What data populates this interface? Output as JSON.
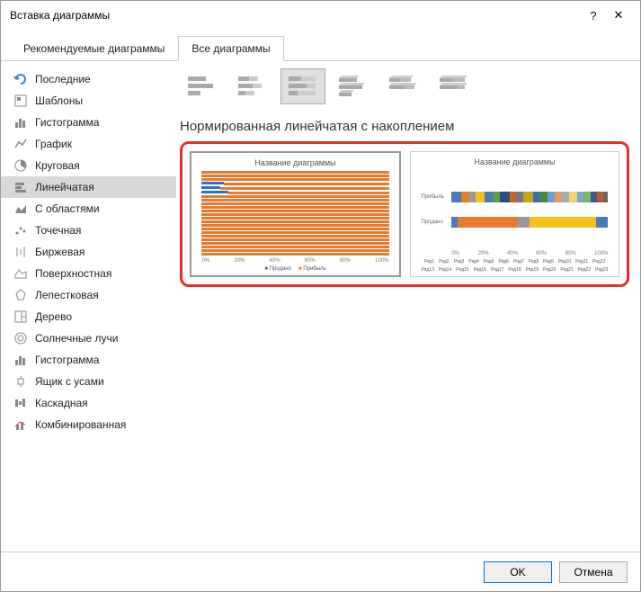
{
  "title": "Вставка диаграммы",
  "help": "?",
  "close": "✕",
  "tabs": {
    "rec": "Рекомендуемые диаграммы",
    "all": "Все диаграммы"
  },
  "sidebar": {
    "items": [
      {
        "label": "Последние"
      },
      {
        "label": "Шаблоны"
      },
      {
        "label": "Гистограмма"
      },
      {
        "label": "График"
      },
      {
        "label": "Круговая"
      },
      {
        "label": "Линейчатая"
      },
      {
        "label": "С областями"
      },
      {
        "label": "Точечная"
      },
      {
        "label": "Биржевая"
      },
      {
        "label": "Поверхностная"
      },
      {
        "label": "Лепестковая"
      },
      {
        "label": "Дерево"
      },
      {
        "label": "Солнечные лучи"
      },
      {
        "label": "Гистограмма"
      },
      {
        "label": "Ящик с усами"
      },
      {
        "label": "Каскадная"
      },
      {
        "label": "Комбинированная"
      }
    ]
  },
  "subtitle": "Нормированная линейчатая с накоплением",
  "preview": {
    "chart_title": "Название диаграммы",
    "legend1": {
      "a": "Продано",
      "b": "Прибыль"
    }
  },
  "chart_data": [
    {
      "type": "bar",
      "orientation": "horizontal-stacked-100",
      "title": "Название диаграммы",
      "xlabel": "",
      "ylabel": "",
      "x_ticks": [
        "0%",
        "20%",
        "40%",
        "60%",
        "80%",
        "100%"
      ],
      "series": [
        {
          "name": "Продано",
          "color": "#3a6fb5"
        },
        {
          "name": "Прибыль",
          "color": "#e87a2e"
        }
      ],
      "categories_count": 23,
      "note": "majority rows ~100% Прибыль; three rows near top show ~10-15% Продано segment"
    },
    {
      "type": "bar",
      "orientation": "horizontal-stacked-100",
      "title": "Название диаграммы",
      "categories": [
        "Прибыль",
        "Продано"
      ],
      "x_ticks": [
        "0%",
        "20%",
        "40%",
        "60%",
        "80%",
        "100%"
      ],
      "series_names": [
        "Ряд1",
        "Ряд2",
        "Ряд3",
        "Ряд4",
        "Ряд5",
        "Ряд6",
        "Ряд7",
        "Ряд8",
        "Ряд9",
        "Ряд10",
        "Ряд11",
        "Ряд12",
        "Ряд13",
        "Ряд14",
        "Ряд15",
        "Ряд16",
        "Ряд17",
        "Ряд18",
        "Ряд19",
        "Ряд20",
        "Ряд21",
        "Ряд22",
        "Ряд23"
      ]
    }
  ],
  "axis_ticks": {
    "t0": "0%",
    "t1": "20%",
    "t2": "40%",
    "t3": "60%",
    "t4": "80%",
    "t5": "100%"
  },
  "chart2": {
    "cat1": "Прибыль",
    "cat2": "Продано"
  },
  "footer": {
    "ok": "OK",
    "cancel": "Отмена"
  }
}
